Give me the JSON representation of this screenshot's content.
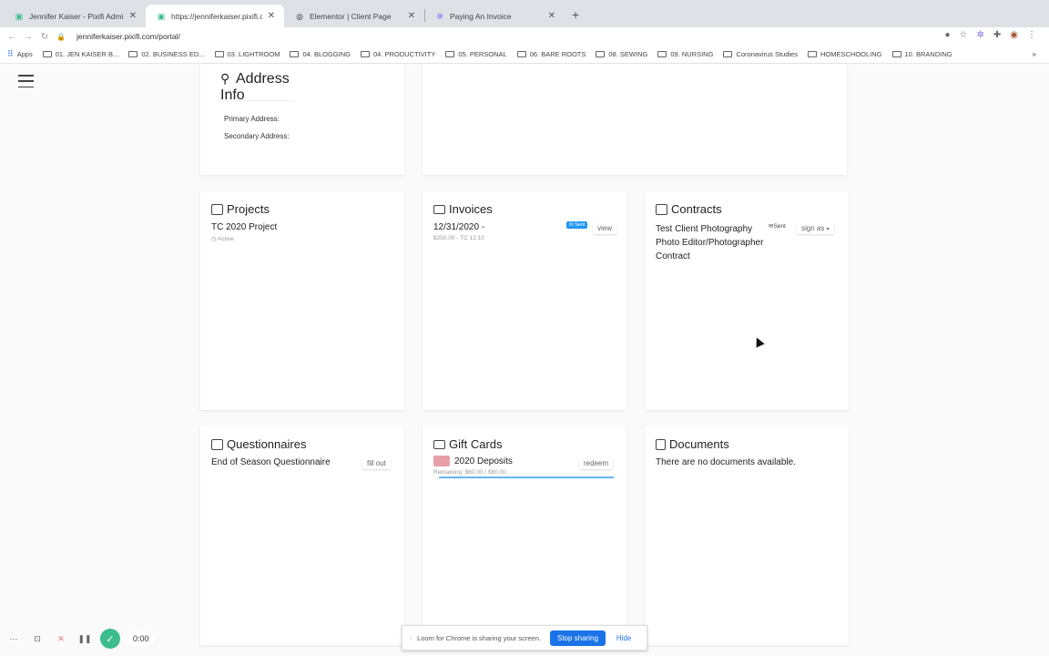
{
  "browser": {
    "tabs": [
      {
        "label": "Jennifer Kaiser - Pixifi Admin",
        "icon": "pixifi-icon"
      },
      {
        "label": "https://jenniferkaiser.pixifi.com",
        "icon": "pixifi-icon"
      },
      {
        "label": "Elementor | Client Page",
        "icon": "globe-icon"
      },
      {
        "label": "Paying An Invoice",
        "icon": "gear-icon"
      }
    ],
    "url": "jenniferkaiser.pixifi.com/portal/",
    "bookmarks": [
      "Apps",
      "01. JEN KAISER B...",
      "02. BUSINESS ED...",
      "03. LIGHTROOM",
      "04. BLOGGING",
      "04. PRODUCTIVITY",
      "05. PERSONAL",
      "06. BARE ROOTS",
      "08. SEWING",
      "09. NURSING",
      "Coronavirus Studies",
      "HOMESCHOOLING",
      "10. BRANDING"
    ],
    "bookmarks_more": "»"
  },
  "address": {
    "title": "Address Info",
    "primary": "Primary Address:",
    "secondary": "Secondary Address:"
  },
  "projects": {
    "title": "Projects",
    "item": "TC 2020 Project",
    "status": "Active"
  },
  "invoices": {
    "title": "Invoices",
    "item": "12/31/2020 -",
    "sub": "$250.00 - TC 12.10",
    "badge": "Sent",
    "button": "view"
  },
  "contracts": {
    "title": "Contracts",
    "item_line1": "Test Client Photography",
    "item_line2": "Photo Editor/Photographer",
    "item_line3": "Contract",
    "status": "Sent",
    "button": "sign as"
  },
  "questionnaires": {
    "title": "Questionnaires",
    "item": "End of Season Questionnaire",
    "button": "fill out"
  },
  "gift_cards": {
    "title": "Gift Cards",
    "item": "2020 Deposits",
    "remaining": "Remaining: $60.00 / $60.00",
    "remaining_fraction": 1.0,
    "button": "redeem"
  },
  "documents": {
    "title": "Documents",
    "empty": "There are no documents available."
  },
  "loom": {
    "timer": "0:00",
    "share_text": "Loom for Chrome is sharing your screen.",
    "stop": "Stop sharing",
    "hide": "Hide"
  }
}
